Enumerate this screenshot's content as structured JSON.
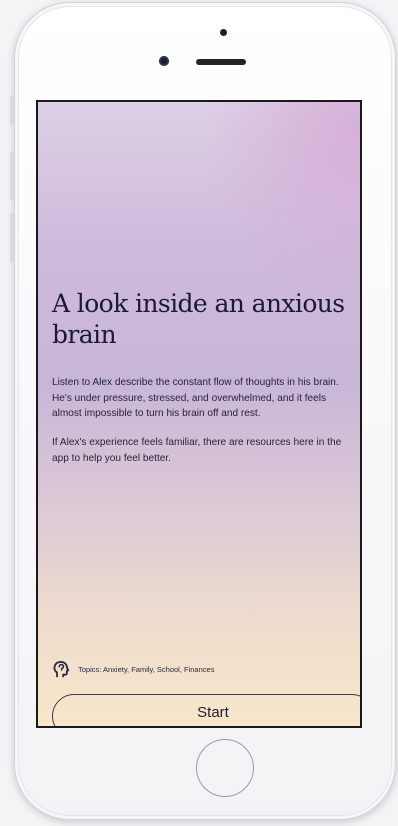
{
  "article": {
    "title": "A look inside an anxious brain",
    "paragraphs": [
      "Listen to Alex describe the constant flow of thoughts in his brain. He's under pressure, stressed, and overwhelmed, and it feels almost impossible to turn his brain off and rest.",
      "If Alex's experience feels familiar, there are resources here in the app to help you feel better."
    ],
    "topics_label": "Topics: Anxiety, Family, School, Finances",
    "topics_icon": "head-profile-icon"
  },
  "actions": {
    "start_label": "Start"
  },
  "colors": {
    "background_top": "#ddd0e6",
    "background_mid": "#c8b6d8",
    "background_bottom": "#f8e7c9",
    "text_primary": "#1b1933",
    "device_frame": "#ffffff"
  }
}
